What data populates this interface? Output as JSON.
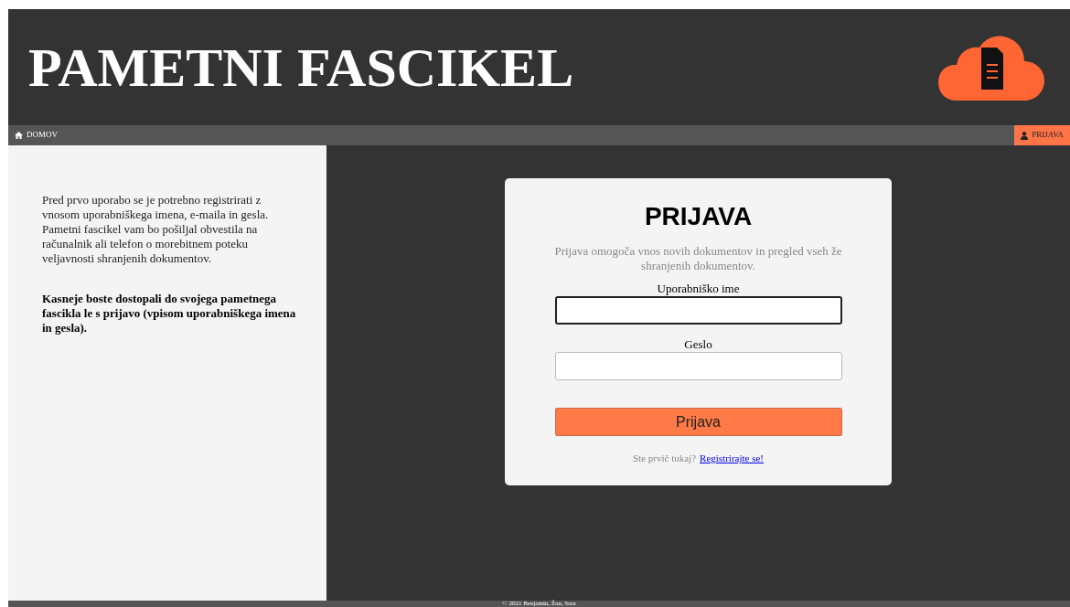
{
  "header": {
    "title": "PAMETNI FASCIKEL"
  },
  "nav": {
    "items": [
      {
        "label": "DOMOV",
        "selected": false
      },
      {
        "label": "PRIJAVA",
        "selected": true
      }
    ]
  },
  "sidebar": {
    "intro": "Pred prvo uporabo se je potrebno registrirati z vnosom uporabniškega imena, e-maila in gesla. Pametni fascikel vam bo pošiljal obvestila na računalnik ali telefon o morebitnem poteku veljavnosti shranjenih dokumentov.",
    "note": "Kasneje boste dostopali do svojega pametnega fascikla le s prijavo (vpisom uporabniškega imena in gesla)."
  },
  "login": {
    "title": "PRIJAVA",
    "description": "Prijava omogoča vnos novih dokumentov in pregled vseh že shranjenih dokumentov.",
    "fields": [
      {
        "label": "Uporabniško ime",
        "focused": true
      },
      {
        "label": "Geslo",
        "focused": false
      }
    ],
    "submit": "Prijava",
    "register_prompt": "Ste prvič tukaj?",
    "register_link": "Registrirajte se!"
  },
  "footer": {
    "text": "© 2021 Benjamin, Žan, Sara"
  }
}
